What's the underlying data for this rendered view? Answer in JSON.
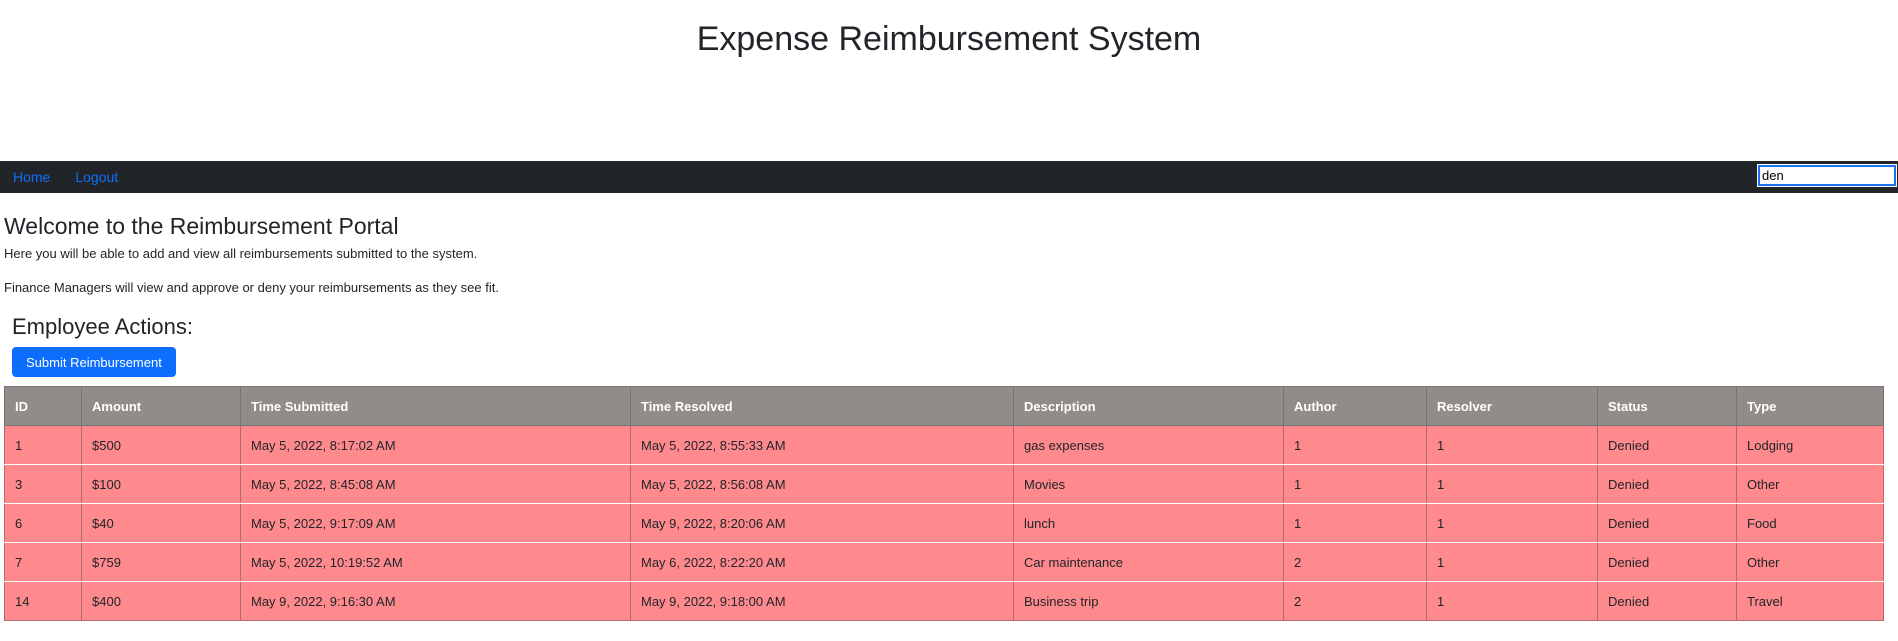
{
  "header": {
    "title": "Expense Reimbursement System"
  },
  "nav": {
    "home_label": "Home",
    "logout_label": "Logout",
    "search_value": "den"
  },
  "welcome": {
    "heading": "Welcome to the Reimbursement Portal",
    "line1": "Here you will be able to add and view all reimbursements submitted to the system.",
    "line2": "Finance Managers will view and approve or deny your reimbursements as they see fit."
  },
  "actions": {
    "heading": "Employee Actions:",
    "submit_label": "Submit Reimbursement"
  },
  "table": {
    "columns": [
      "ID",
      "Amount",
      "Time Submitted",
      "Time Resolved",
      "Description",
      "Author",
      "Resolver",
      "Status",
      "Type"
    ],
    "rows": [
      [
        "1",
        "$500",
        "May 5, 2022, 8:17:02 AM",
        "May 5, 2022, 8:55:33 AM",
        "gas expenses",
        "1",
        "1",
        "Denied",
        "Lodging"
      ],
      [
        "3",
        "$100",
        "May 5, 2022, 8:45:08 AM",
        "May 5, 2022, 8:56:08 AM",
        "Movies",
        "1",
        "1",
        "Denied",
        "Other"
      ],
      [
        "6",
        "$40",
        "May 5, 2022, 9:17:09 AM",
        "May 9, 2022, 8:20:06 AM",
        "lunch",
        "1",
        "1",
        "Denied",
        "Food"
      ],
      [
        "7",
        "$759",
        "May 5, 2022, 10:19:52 AM",
        "May 6, 2022, 8:22:20 AM",
        "Car maintenance",
        "2",
        "1",
        "Denied",
        "Other"
      ],
      [
        "14",
        "$400",
        "May 9, 2022, 9:16:30 AM",
        "May 9, 2022, 9:18:00 AM",
        "Business trip",
        "2",
        "1",
        "Denied",
        "Travel"
      ]
    ]
  },
  "colors": {
    "navbar": "#212529",
    "link": "#0d6efd",
    "header_row": "#918b89",
    "denied_row": "#ff8a8e",
    "primary_button": "#0d6efd"
  }
}
